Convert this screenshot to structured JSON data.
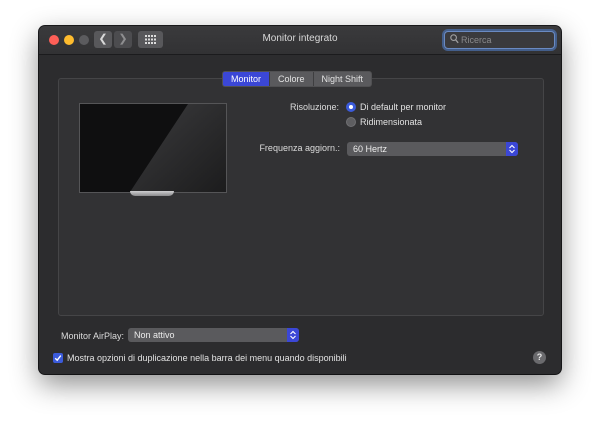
{
  "window": {
    "title": "Monitor integrato",
    "search_placeholder": "Ricerca"
  },
  "tabs": [
    {
      "label": "Monitor",
      "active": true
    },
    {
      "label": "Colore",
      "active": false
    },
    {
      "label": "Night Shift",
      "active": false
    }
  ],
  "resolution": {
    "label": "Risoluzione:",
    "options": [
      {
        "label": "Di default per monitor",
        "selected": true
      },
      {
        "label": "Ridimensionata",
        "selected": false
      }
    ]
  },
  "refresh_rate": {
    "label": "Frequenza aggiorn.:",
    "value": "60 Hertz"
  },
  "airplay": {
    "label": "Monitor AirPlay:",
    "value": "Non attivo"
  },
  "mirroring_option": {
    "label": "Mostra opzioni di duplicazione nella barra dei menu quando disponibili",
    "checked": true
  },
  "help": {
    "label": "?"
  },
  "colors": {
    "accent": "#3b47d6",
    "window_bg": "#2c2c2e"
  }
}
